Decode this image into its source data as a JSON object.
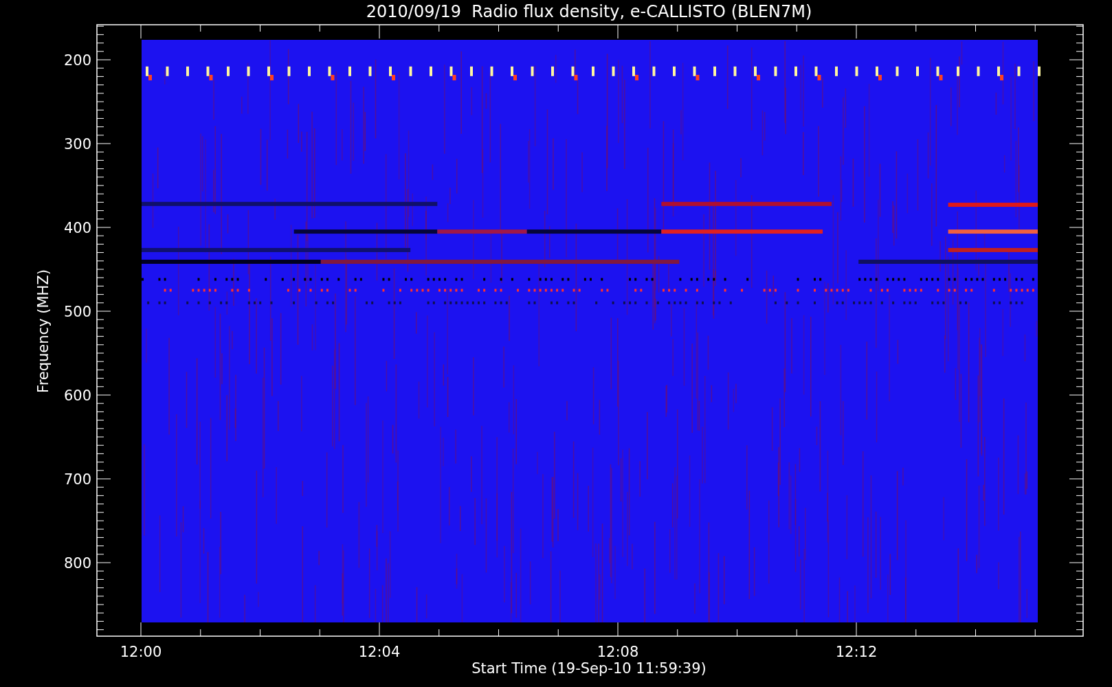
{
  "title": "2010/09/19  Radio flux density, e-CALLISTO (BLEN7M)",
  "y_axis": {
    "label": "Frequency (MHZ)",
    "ticks": [
      "200",
      "300",
      "400",
      "500",
      "600",
      "700",
      "800"
    ]
  },
  "x_axis": {
    "label": "Start Time (19-Sep-10 11:59:39)",
    "ticks": [
      "12:00",
      "12:04",
      "12:08",
      "12:12"
    ]
  }
}
